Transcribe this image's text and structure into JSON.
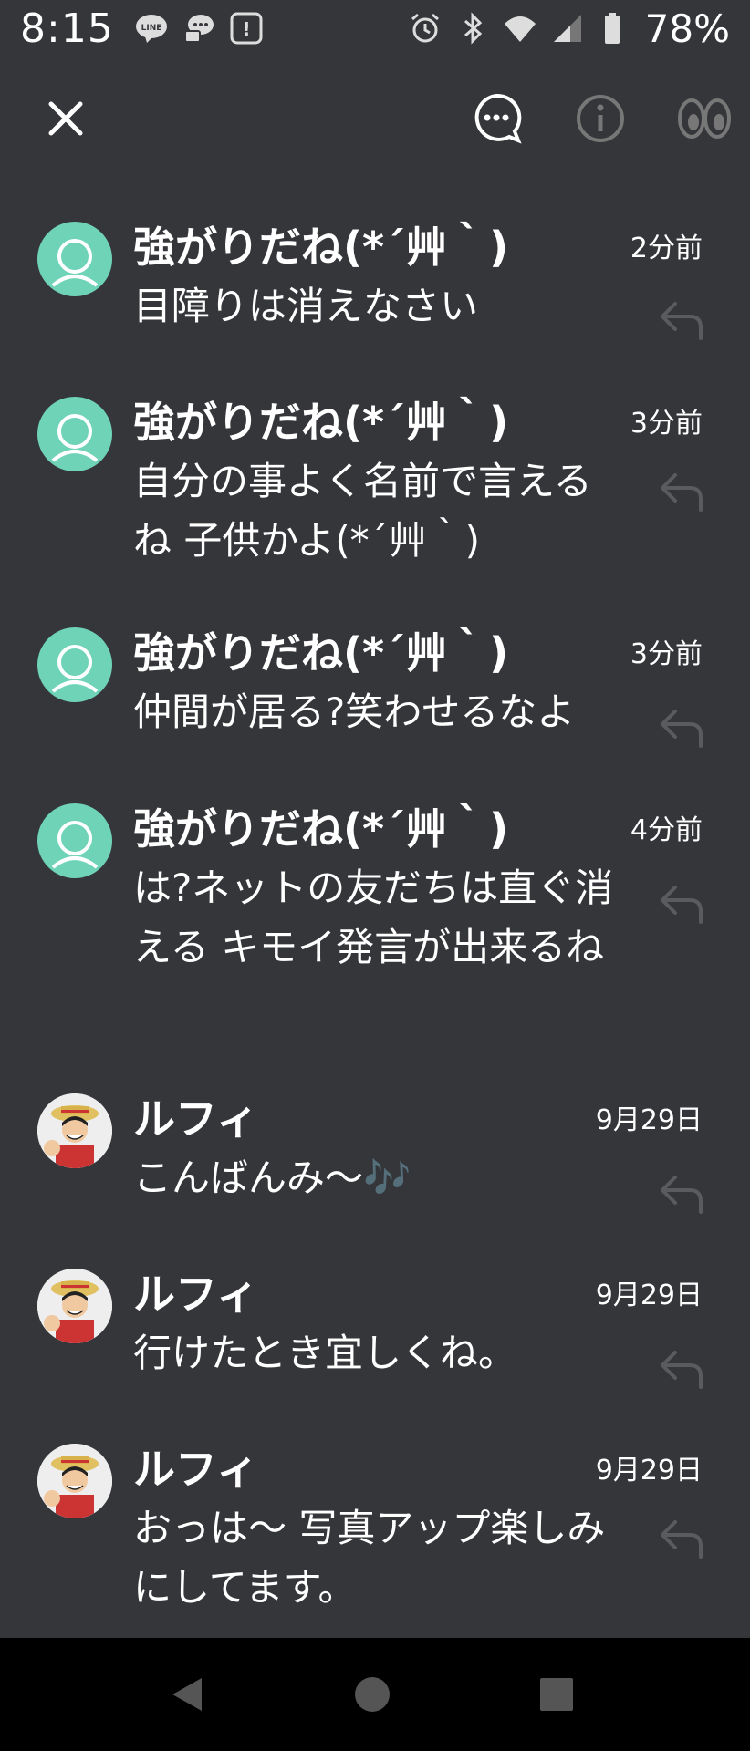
{
  "status_bar": {
    "time": "8:15",
    "battery": "78%",
    "left_icons": [
      "line-icon",
      "chat-bubble-icon",
      "notification-app-icon"
    ],
    "right_icons": [
      "alarm-icon",
      "bluetooth-icon",
      "wifi-icon",
      "signal-icon",
      "battery-icon"
    ]
  },
  "toolbar": {
    "icons": [
      "close-icon",
      "chat-more-icon",
      "info-icon",
      "eyes-icon"
    ]
  },
  "messages": [
    {
      "name": "強がりだね(*´艸｀)",
      "time": "2分前",
      "text": "目障りは消えなさい",
      "avatar": "default"
    },
    {
      "name": "強がりだね(*´艸｀)",
      "time": "3分前",
      "text": "自分の事よく名前で言えるね 子供かよ(*´艸｀)",
      "avatar": "default"
    },
    {
      "name": "強がりだね(*´艸｀)",
      "time": "3分前",
      "text": "仲間が居る?笑わせるなよ",
      "avatar": "default"
    },
    {
      "name": "強がりだね(*´艸｀)",
      "time": "4分前",
      "text": "は?ネットの友だちは直ぐ消える キモイ発言が出来るね",
      "avatar": "default"
    },
    {
      "name": "ルフィ",
      "time": "9月29日",
      "text": "こんばんみ〜🎶",
      "avatar": "luffy"
    },
    {
      "name": "ルフィ",
      "time": "9月29日",
      "text": "行けたとき宜しくね。",
      "avatar": "luffy"
    },
    {
      "name": "ルフィ",
      "time": "9月29日",
      "text": "おっは〜 写真アップ楽しみにしてます。",
      "avatar": "luffy"
    }
  ],
  "nav_bar": {
    "icons": [
      "back-icon",
      "home-icon",
      "recents-icon"
    ]
  },
  "colors": {
    "background": "#35363a",
    "avatar_default": "#6fd3b8",
    "nav_background": "#000000"
  }
}
